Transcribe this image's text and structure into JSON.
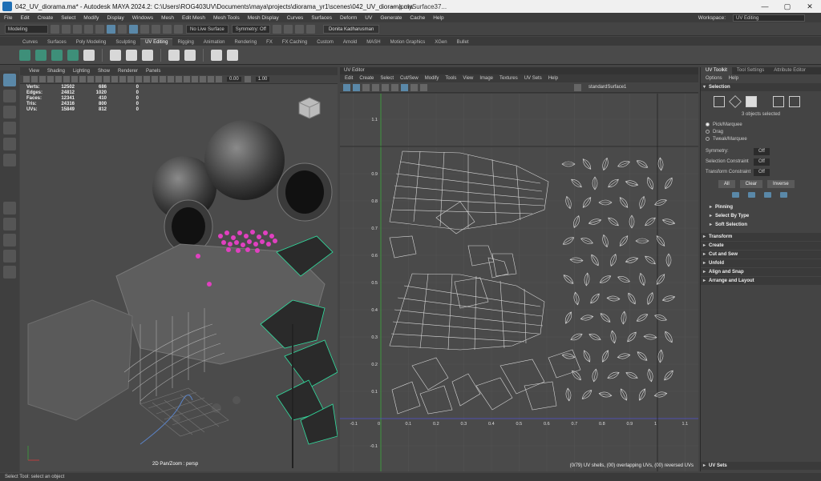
{
  "titlebar": {
    "title": "042_UV_diorama.ma* - Autodesk MAYA 2024.2: C:\\Users\\ROG403UV\\Documents\\maya\\projects\\diorama_yr1\\scenes\\042_UV_diorama.ma",
    "suffix": "---    |polySurface37...",
    "minimize": "—",
    "maximize": "▢",
    "close": "✕"
  },
  "menubar": {
    "items": [
      "File",
      "Edit",
      "Create",
      "Select",
      "Modify",
      "Display",
      "Windows",
      "Mesh",
      "Edit Mesh",
      "Mesh Tools",
      "Mesh Display",
      "Curves",
      "Surfaces",
      "Deform",
      "UV",
      "Generate",
      "Cache",
      "Help"
    ],
    "workspace_label": "Workspace:",
    "workspace_value": "UV Editing"
  },
  "statusline": {
    "mode": "Modeling",
    "live_surface": "No Live Surface",
    "symmetry": "Symmetry: Off",
    "user": "Donita Kadharusman"
  },
  "shelf_tabs": [
    "Curves",
    "Surfaces",
    "Poly Modeling",
    "Sculpting",
    "UV Editing",
    "Rigging",
    "Animation",
    "Rendering",
    "FX",
    "FX Caching",
    "Custom",
    "Arnold",
    "MASH",
    "Motion Graphics",
    "XGen",
    "Bullet"
  ],
  "shelf_active_tab": "UV Editing",
  "viewport": {
    "menu": [
      "View",
      "Shading",
      "Lighting",
      "Show",
      "Renderer",
      "Panels"
    ],
    "field1": "0.00",
    "field2": "1.00",
    "hud": [
      {
        "label": "Verts:",
        "v1": "12502",
        "v2": "686",
        "v3": "0"
      },
      {
        "label": "Edges:",
        "v1": "24812",
        "v2": "1020",
        "v3": "0"
      },
      {
        "label": "Faces:",
        "v1": "12341",
        "v2": "410",
        "v3": "0"
      },
      {
        "label": "Tris:",
        "v1": "24316",
        "v2": "800",
        "v3": "0"
      },
      {
        "label": "UVs:",
        "v1": "15849",
        "v2": "812",
        "v3": "0"
      }
    ],
    "label": "2D Pan/Zoom : persp"
  },
  "uveditor": {
    "header": "UV Editor",
    "menu": [
      "Edit",
      "Create",
      "Select",
      "Cut/Sew",
      "Modify",
      "Tools",
      "View",
      "Image",
      "Textures",
      "UV Sets",
      "Help"
    ],
    "texture": "standardSurface1",
    "status": "(0/79) UV shells, (00) overlapping UVs, (00) reversed UVs",
    "ticks_u": [
      "-0.1",
      "0",
      "0.1",
      "0.2",
      "0.3",
      "0.4",
      "0.5",
      "0.6",
      "0.7",
      "0.8",
      "0.9",
      "1",
      "1.1"
    ],
    "ticks_v": [
      "1.1",
      "0.9",
      "0.8",
      "0.7",
      "0.6",
      "0.5",
      "0.4",
      "0.3",
      "0.2",
      "0.1",
      "-0.1"
    ]
  },
  "toolkit": {
    "tabs": [
      "UV Toolkit",
      "Tool Settings",
      "Attribute Editor"
    ],
    "menu": [
      "Options",
      "Help"
    ],
    "selection_header": "Selection",
    "selected": "3 objects selected",
    "modes": [
      "Pick/Marquee",
      "Drag",
      "Tweak/Marquee"
    ],
    "symmetry_label": "Symmetry:",
    "symmetry_value": "Off",
    "sel_constraint_label": "Selection Constraint",
    "sel_constraint_value": "Off",
    "xform_constraint_label": "Transform Constraint",
    "xform_constraint_value": "Off",
    "buttons": [
      "All",
      "Clear",
      "Inverse"
    ],
    "subsections": [
      "Pinning",
      "Select By Type",
      "Soft Selection"
    ],
    "sections": [
      "Transform",
      "Create",
      "Cut and Sew",
      "Unfold",
      "Align and Snap",
      "Arrange and Layout"
    ],
    "uvsets": "UV Sets"
  },
  "statusbar": {
    "text": "Select Tool: select an object"
  },
  "colors": {
    "accent": "#5a88a8",
    "selection_green": "#30e0a0",
    "particle_magenta": "#e040c0"
  }
}
